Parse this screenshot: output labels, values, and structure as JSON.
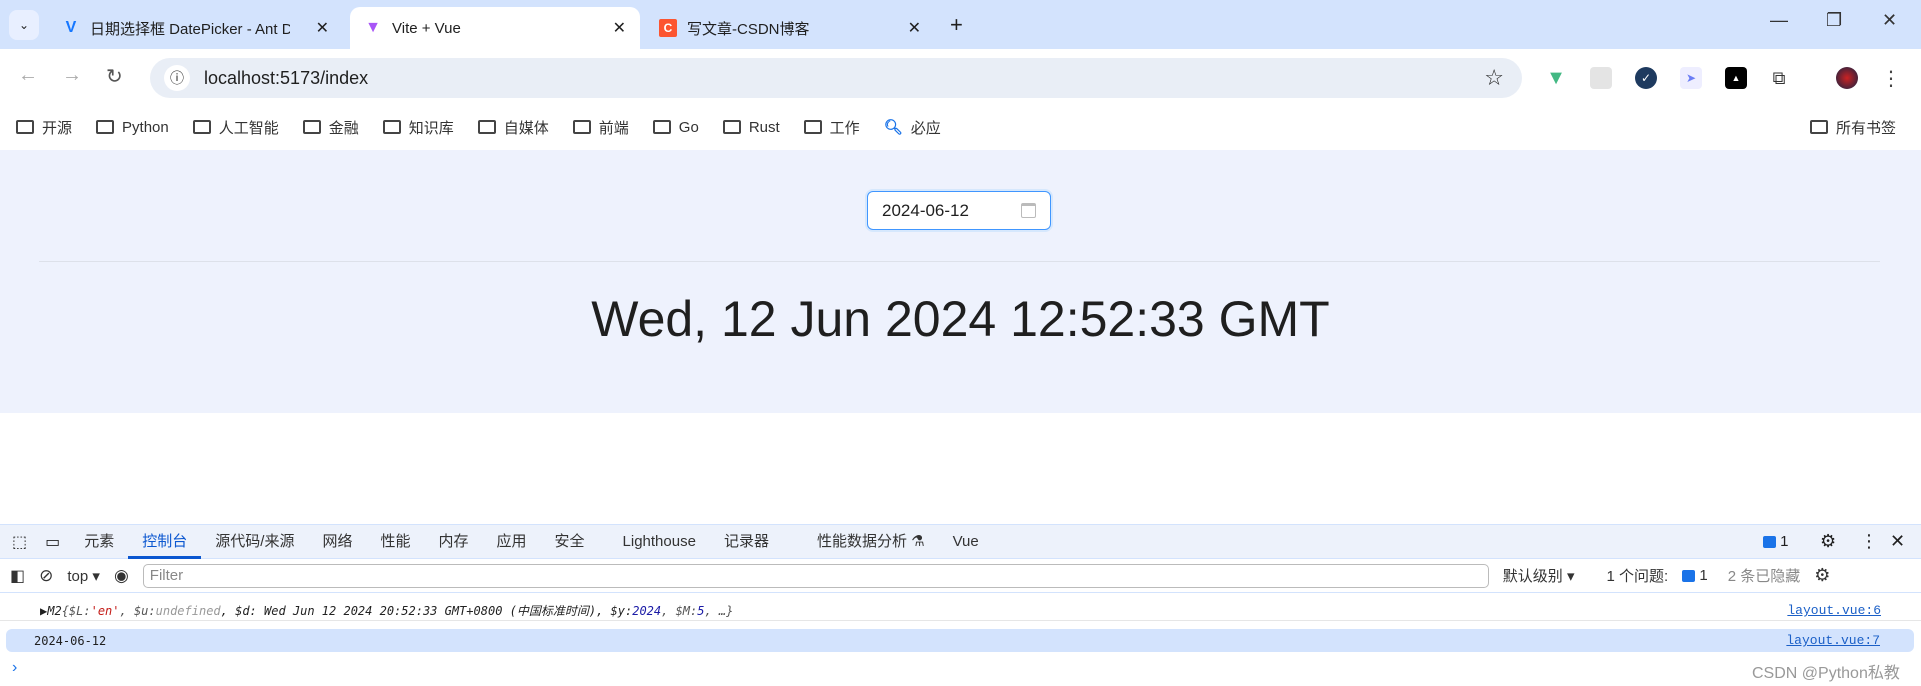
{
  "browser": {
    "tabs": [
      {
        "title": "日期选择框 DatePicker - Ant D",
        "icon": "ant-design-icon",
        "active": false
      },
      {
        "title": "Vite + Vue",
        "icon": "vite-icon",
        "active": true
      },
      {
        "title": "写文章-CSDN博客",
        "icon": "csdn-icon",
        "active": false
      }
    ],
    "url": "localhost:5173/index",
    "bookmarks": [
      "开源",
      "Python",
      "人工智能",
      "金融",
      "知识库",
      "自媒体",
      "前端",
      "Go",
      "Rust",
      "工作"
    ],
    "bing_bookmark": "必应",
    "all_bookmarks": "所有书签",
    "extensions": [
      "vue-devtools-icon",
      "grid-extension-icon",
      "check-extension-icon",
      "bird-extension-icon",
      "astar-extension-icon",
      "puzzle-icon"
    ]
  },
  "page": {
    "date_value": "2024-06-12",
    "display": "Wed, 12 Jun 2024 12:52:33 GMT",
    "bg_color": "#eef2fd",
    "accent": "#4096ff"
  },
  "devtools": {
    "tabs": [
      "元素",
      "控制台",
      "源代码/来源",
      "网络",
      "性能",
      "内存",
      "应用",
      "安全",
      "Lighthouse",
      "记录器",
      "性能数据分析 ⚗",
      "Vue"
    ],
    "active_tab": "控制台",
    "issue_count": "1",
    "context": "top",
    "filter_placeholder": "Filter",
    "level": "默认级别",
    "issues_label": "1 个问题:",
    "issues_count": "1",
    "hidden": "2 条已隐藏",
    "messages": [
      {
        "prefix": "M2",
        "body_parts": [
          " {$L: ",
          "'en'",
          ", $u: ",
          "undefined",
          ", $d: Wed Jun 12 2024 20:52:33 GMT+0800 (中国标准时间), $y: ",
          "2024",
          ", $M: ",
          "5",
          ",  …}"
        ],
        "source": "layout.vue:6"
      },
      {
        "text": "2024-06-12",
        "source": "layout.vue:7"
      }
    ]
  },
  "watermark": "CSDN @Python私教"
}
